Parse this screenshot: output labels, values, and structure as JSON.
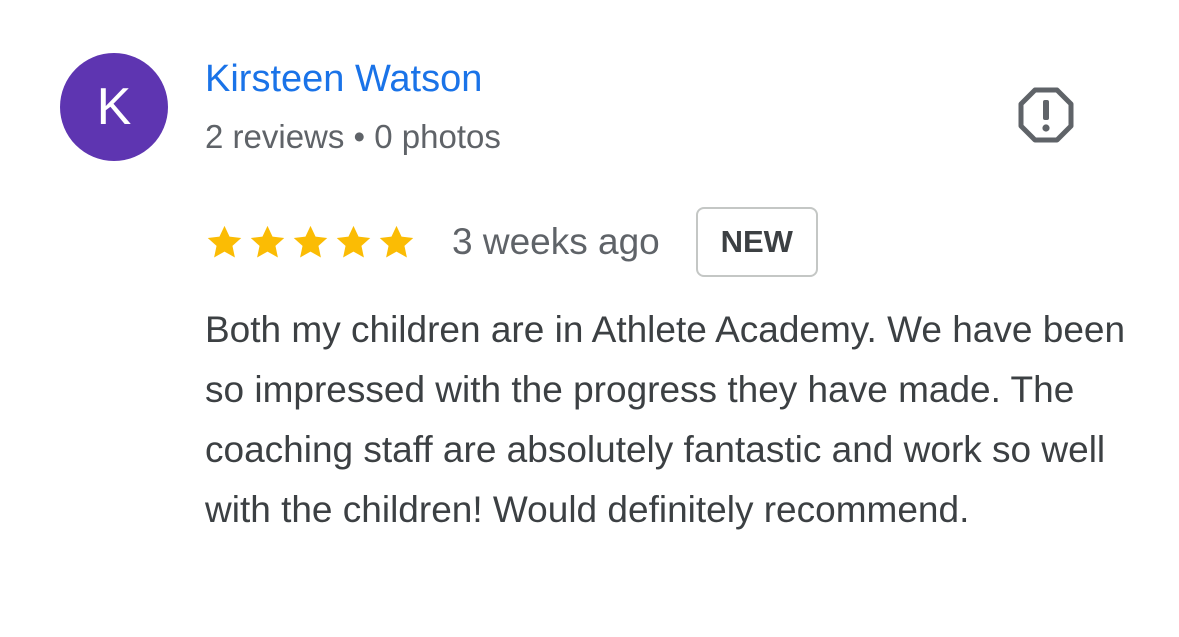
{
  "reviewer": {
    "avatar_letter": "K",
    "name": "Kirsteen Watson",
    "meta": "2 reviews • 0 photos"
  },
  "review": {
    "rating": 5,
    "rating_max": 5,
    "date": "3 weeks ago",
    "badge": "NEW",
    "text": "Both my children are in Athlete Academy. We have been so impressed with the progress they have made. The coaching staff are absolutely fantastic and work so well with the children! Would definitely recommend."
  },
  "icons": {
    "report": "report-flag-icon",
    "star": "star-filled-icon"
  },
  "colors": {
    "avatar_bg": "#5e35b1",
    "name_link": "#1a73e8",
    "star": "#fbbc04",
    "text": "#3c4043",
    "meta": "#5f6368"
  }
}
